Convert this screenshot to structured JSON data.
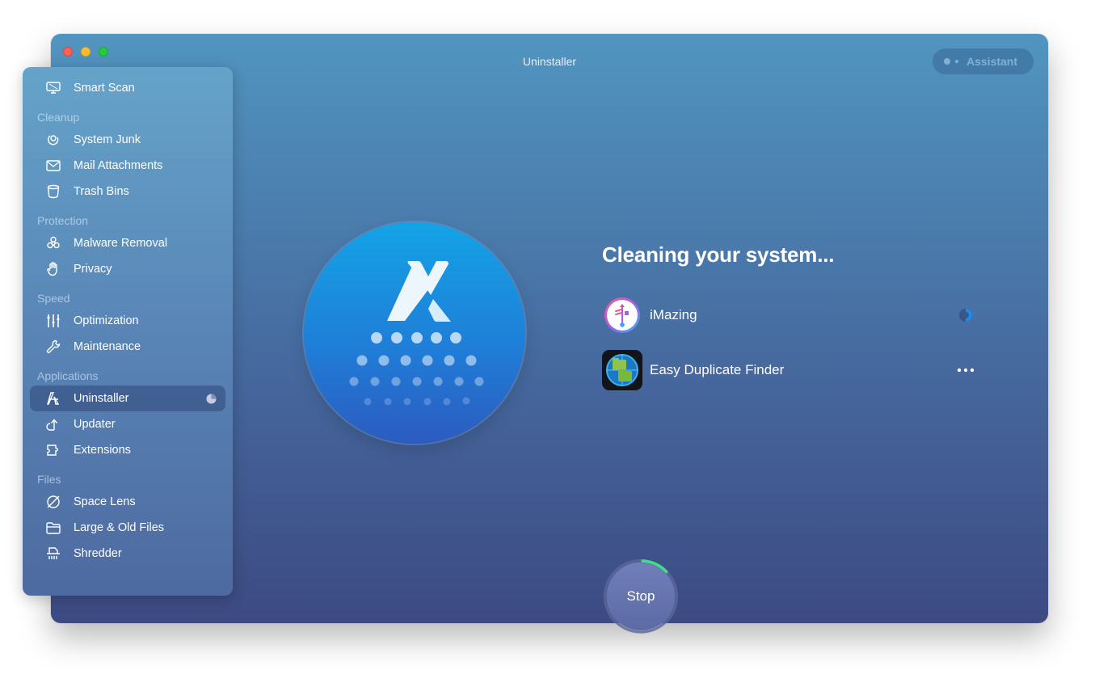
{
  "window": {
    "title": "Uninstaller",
    "assistant_label": "Assistant"
  },
  "sidebar": {
    "top_item": {
      "label": "Smart Scan",
      "icon": "monitor-icon"
    },
    "sections": [
      {
        "label": "Cleanup",
        "items": [
          {
            "label": "System Junk",
            "icon": "system-junk-icon"
          },
          {
            "label": "Mail Attachments",
            "icon": "mail-icon"
          },
          {
            "label": "Trash Bins",
            "icon": "trash-icon"
          }
        ]
      },
      {
        "label": "Protection",
        "items": [
          {
            "label": "Malware Removal",
            "icon": "biohazard-icon"
          },
          {
            "label": "Privacy",
            "icon": "hand-icon"
          }
        ]
      },
      {
        "label": "Speed",
        "items": [
          {
            "label": "Optimization",
            "icon": "sliders-icon"
          },
          {
            "label": "Maintenance",
            "icon": "wrench-icon"
          }
        ]
      },
      {
        "label": "Applications",
        "items": [
          {
            "label": "Uninstaller",
            "icon": "uninstaller-icon",
            "active": true,
            "progress_indicator": "pie-progress-icon"
          },
          {
            "label": "Updater",
            "icon": "updater-icon"
          },
          {
            "label": "Extensions",
            "icon": "puzzle-icon"
          }
        ]
      },
      {
        "label": "Files",
        "items": [
          {
            "label": "Space Lens",
            "icon": "planet-icon"
          },
          {
            "label": "Large & Old Files",
            "icon": "folder-icon"
          },
          {
            "label": "Shredder",
            "icon": "shredder-icon"
          }
        ]
      }
    ]
  },
  "main": {
    "heading": "Cleaning your system...",
    "apps": [
      {
        "name": "iMazing",
        "icon": "imazing-app-icon",
        "status": "in-progress",
        "status_icon": "spinner-icon"
      },
      {
        "name": "Easy Duplicate Finder",
        "icon": "easy-duplicate-finder-app-icon",
        "status": "pending",
        "status_icon": "more-dots-icon"
      }
    ],
    "stop_button": {
      "label": "Stop",
      "progress": 0.12
    }
  },
  "colors": {
    "accent_blue": "#1a8cf0",
    "progress_green": "#3ee08a",
    "traffic_red": "#fe5f57",
    "traffic_yellow": "#febc2e",
    "traffic_green": "#28c840"
  }
}
